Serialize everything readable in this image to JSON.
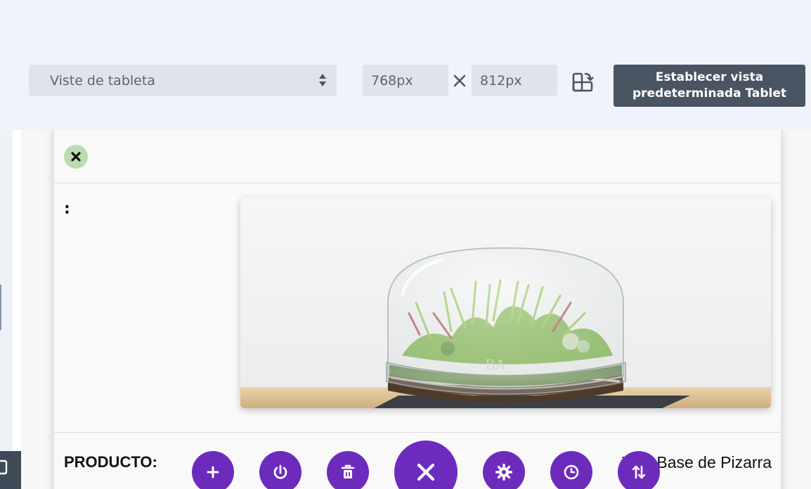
{
  "toolbar": {
    "view_select": {
      "value": "Viste de tableta"
    },
    "width_input": {
      "value": "768px"
    },
    "height_input": {
      "value": "812px"
    },
    "set_default_label": "Establecer vista predeterminada Tablet"
  },
  "card": {
    "colon_text": ":",
    "product_label": "PRODUCTO:",
    "product_name": "Yuki Base de Pizarra",
    "image_watermark": "BA"
  },
  "fab_actions": [
    {
      "name": "add",
      "icon": "plus-icon"
    },
    {
      "name": "power",
      "icon": "power-icon"
    },
    {
      "name": "delete",
      "icon": "trash-icon"
    },
    {
      "name": "close",
      "icon": "close-icon"
    },
    {
      "name": "settings",
      "icon": "gear-icon"
    },
    {
      "name": "history",
      "icon": "clock-icon"
    },
    {
      "name": "sort",
      "icon": "sort-arrows-icon"
    }
  ],
  "colors": {
    "accent_purple": "#6d2bbd",
    "dark_button": "#4a5563",
    "input_bg": "#dfe4ec",
    "close_badge": "#bcdcb0"
  }
}
